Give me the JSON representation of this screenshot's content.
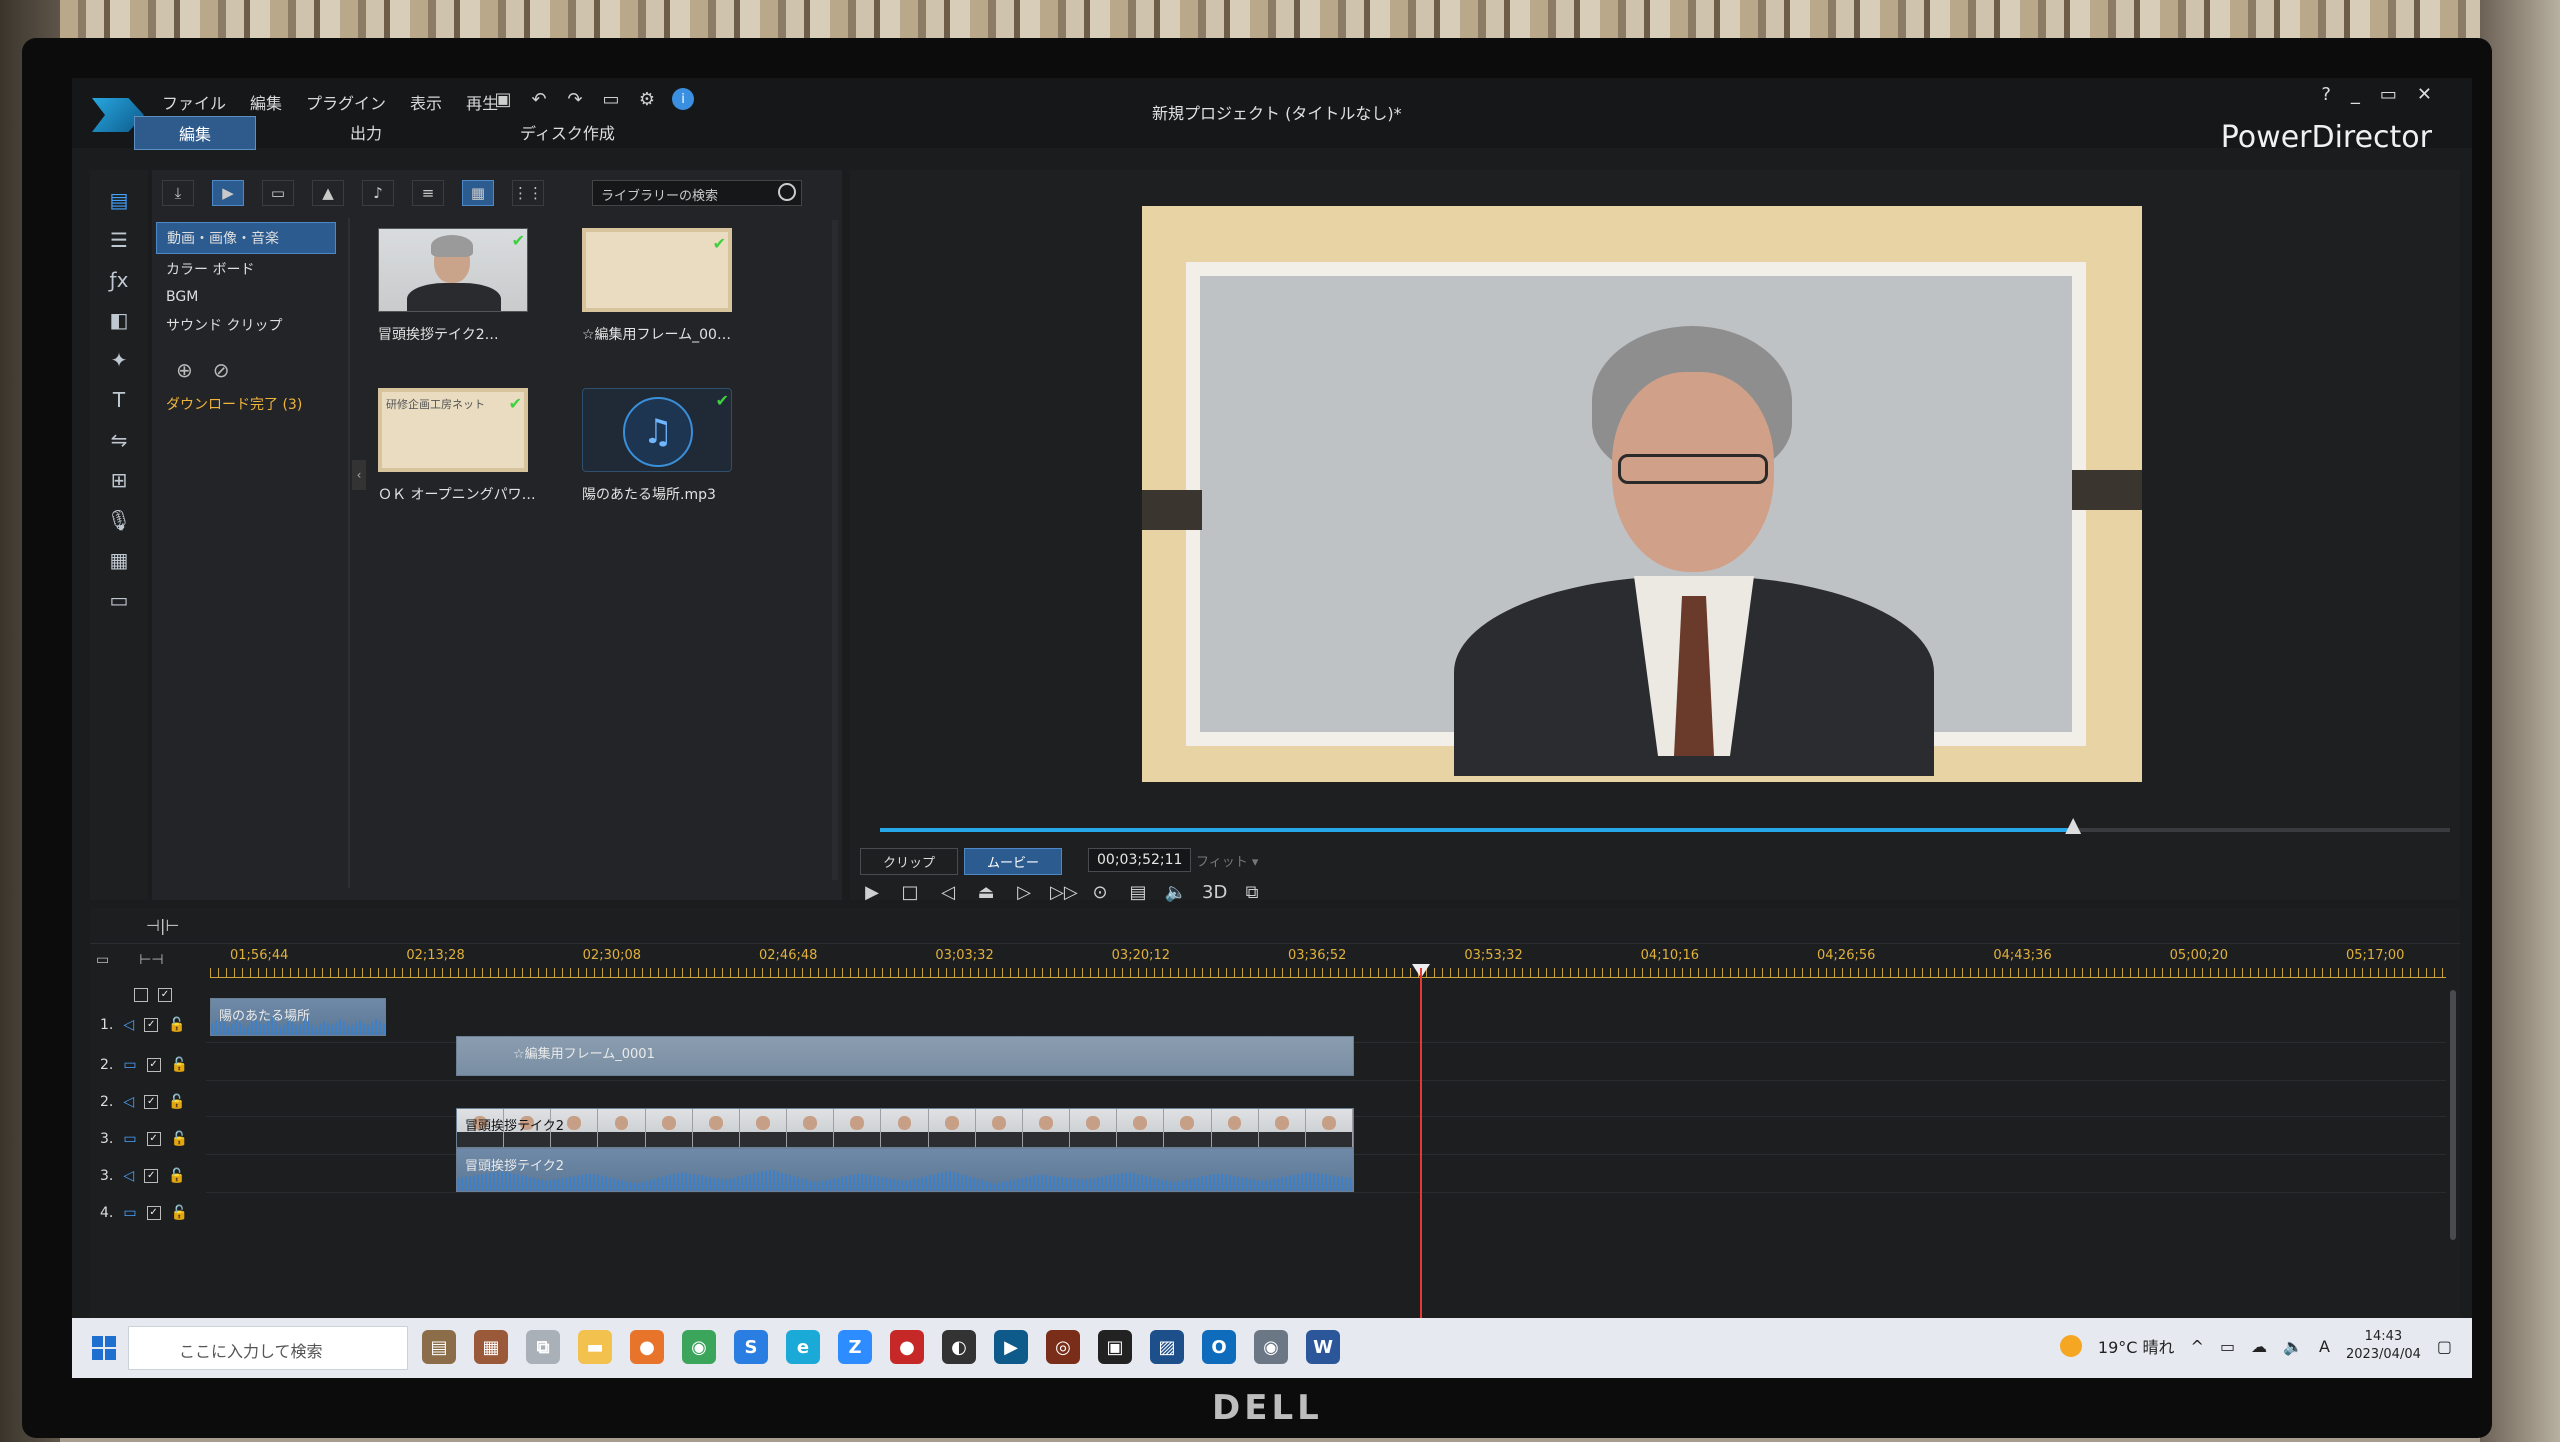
{
  "app": {
    "menu": [
      "ファイル",
      "編集",
      "プラグイン",
      "表示",
      "再生"
    ],
    "project_title": "新規プロジェクト (タイトルなし)*",
    "brand": "PowerDirector",
    "mode_tabs": [
      "編集",
      "出力",
      "ディスク作成"
    ],
    "active_mode": "編集",
    "window_controls": [
      "?",
      "_",
      "▭",
      "✕"
    ]
  },
  "library": {
    "search_placeholder": "ライブラリーの検索",
    "categories": [
      "動画・画像・音楽",
      "カラー ボード",
      "BGM",
      "サウンド クリップ"
    ],
    "active_category": "動画・画像・音楽",
    "download": "ダウンロード完了 (3)",
    "items": [
      {
        "label": "冒頭挨拶テイク2…",
        "type": "video"
      },
      {
        "label": "☆編集用フレーム_00…",
        "type": "frame"
      },
      {
        "label": "ＯＫ オープニングパワ…",
        "type": "frame",
        "thumb_text": "研修企画工房ネット"
      },
      {
        "label": "陽のあたる場所.mp3",
        "type": "music"
      }
    ]
  },
  "preview": {
    "mode_clip": "クリップ",
    "mode_movie": "ムービー",
    "active_mode": "ムービー",
    "timecode": "00;03;52;11",
    "fit": "フィット",
    "progress": 0.76,
    "controls": [
      "play",
      "stop",
      "prev-frame",
      "snapshot-frame",
      "next-frame",
      "fast-forward",
      "camera",
      "subtitles",
      "volume",
      "3D",
      "undock"
    ],
    "three_d_label": "3D"
  },
  "timeline": {
    "ruler_labels": [
      "01;56;44",
      "02;13;28",
      "02;30;08",
      "02;46;48",
      "03;03;32",
      "03;20;12",
      "03;36;52",
      "03;53;32",
      "04;10;16",
      "04;26;56",
      "04;43;36",
      "05;00;20",
      "05;17;00"
    ],
    "tracks": [
      {
        "num": "1.",
        "kind": "audio"
      },
      {
        "num": "2.",
        "kind": "video"
      },
      {
        "num": "2.",
        "kind": "audio"
      },
      {
        "num": "3.",
        "kind": "video"
      },
      {
        "num": "3.",
        "kind": "audio"
      },
      {
        "num": "4.",
        "kind": "video"
      }
    ],
    "clips": {
      "bgm": "陽のあたる場所",
      "frame": "☆編集用フレーム_0001",
      "video": "冒頭挨拶テイク2",
      "video_audio": "冒頭挨拶テイク2"
    }
  },
  "taskbar": {
    "search_placeholder": "ここに入力して検索",
    "weather": "19°C 晴れ",
    "ime": "A",
    "time": "14:43",
    "date": "2023/04/04"
  },
  "colors": {
    "accent": "#26a8e8",
    "active_tab": "#2c5b8f",
    "ruler": "#e0b13c",
    "playhead": "#e53935"
  },
  "hardware": {
    "monitor_brand": "DELL"
  }
}
